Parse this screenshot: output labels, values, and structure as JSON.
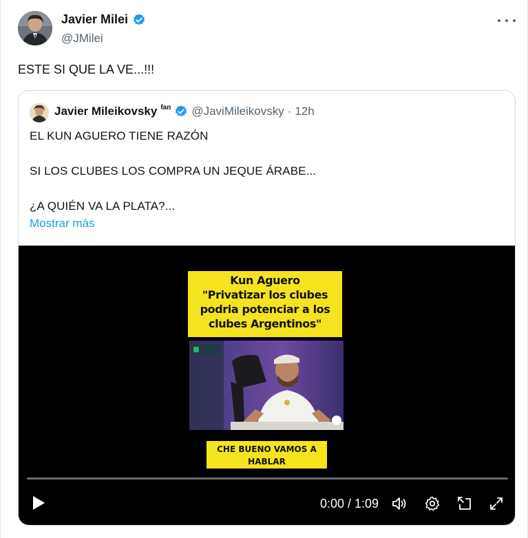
{
  "author": {
    "name": "Javier Milei",
    "handle": "@JMilei",
    "verified_color": "#1d9bf0"
  },
  "menu_icon": "more-horizontal-icon",
  "tweet": {
    "text": "ESTE SI QUE LA VE...!!!"
  },
  "quoted": {
    "name": "Javier Mileikovsky",
    "fan_tag": "fan",
    "handle": "@JaviMileikovsky",
    "separator": "·",
    "time": "12h",
    "lines": [
      "EL KUN AGUERO TIENE RAZÓN",
      "SI LOS CLUBES LOS COMPRA UN JEQUE ÁRABE...",
      "¿A QUIÉN VA LA PLATA?..."
    ],
    "show_more": "Mostrar más"
  },
  "video": {
    "caption_lines": [
      "Kun Aguero",
      "\"Privatizar los clubes",
      "podria  potenciar a los",
      "clubes Argentinos\""
    ],
    "bottom_lines": [
      "CHE BUENO VAMOS A",
      "HABLAR"
    ],
    "time": "0:00 / 1:09",
    "progress": 0,
    "accent": "#f6e31f",
    "controls": [
      "play-icon",
      "volume-icon",
      "settings-icon",
      "pip-icon",
      "fullscreen-icon"
    ]
  }
}
